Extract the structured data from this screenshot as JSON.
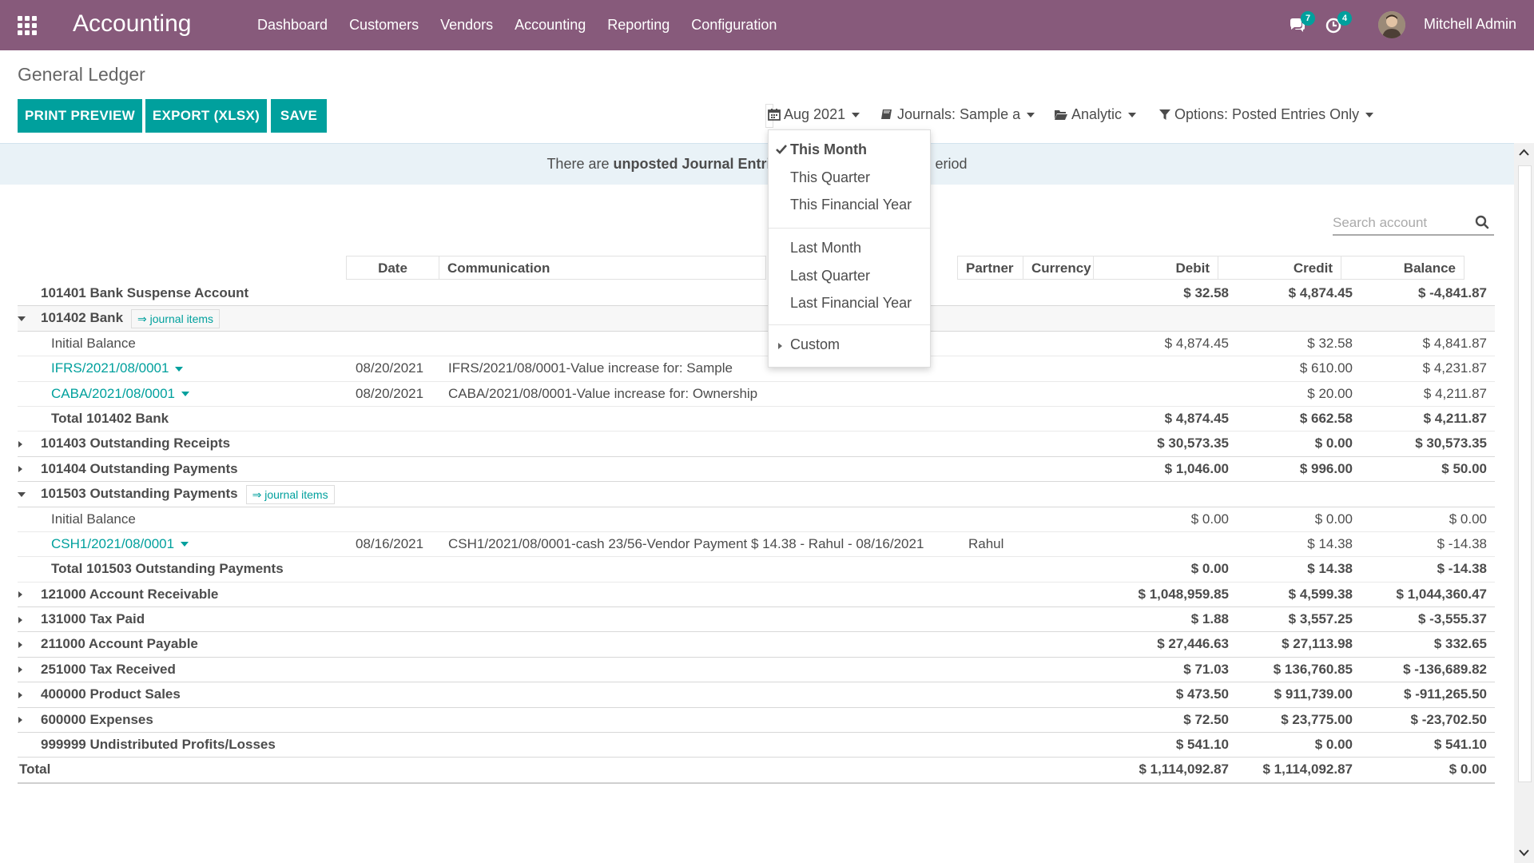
{
  "navbar": {
    "app_title": "Accounting",
    "menu": [
      "Dashboard",
      "Customers",
      "Vendors",
      "Accounting",
      "Reporting",
      "Configuration"
    ],
    "messages_count": "7",
    "activities_count": "4",
    "user_name": "Mitchell Admin",
    "color": "#875a7b"
  },
  "page": {
    "title": "General Ledger",
    "buttons": {
      "print_preview": "PRINT PREVIEW",
      "export": "EXPORT (XLSX)",
      "save": "SAVE"
    },
    "accent": "#00a09d"
  },
  "filters": {
    "date": "Aug 2021",
    "journals": "Journals: Sample a",
    "analytic": "Analytic",
    "options": "Options: Posted Entries Only"
  },
  "alert": {
    "prefix": "There are ",
    "bold": "unposted Journal Entrie",
    "suffix": "eriod"
  },
  "search": {
    "placeholder": "Search account"
  },
  "table": {
    "headers": {
      "date": "Date",
      "communication": "Communication",
      "partner": "Partner",
      "currency": "Currency",
      "debit": "Debit",
      "credit": "Credit",
      "balance": "Balance"
    },
    "r1": {
      "name": "101401 Bank Suspense Account",
      "debit": "$ 32.58",
      "credit": "$ 4,874.45",
      "balance": "$ -4,841.87"
    },
    "r2": {
      "name": "101402 Bank",
      "link": "⇒ journal items"
    },
    "r3": {
      "name": "Initial Balance",
      "debit": "$ 4,874.45",
      "credit": "$ 32.58",
      "balance": "$ 4,841.87"
    },
    "r4": {
      "name": "IFRS/2021/08/0001",
      "date": "08/20/2021",
      "comm": "IFRS/2021/08/0001-Value increase for: Sample",
      "credit": "$ 610.00",
      "balance": "$ 4,231.87"
    },
    "r5": {
      "name": "CABA/2021/08/0001",
      "date": "08/20/2021",
      "comm": "CABA/2021/08/0001-Value increase for: Ownership",
      "credit": "$ 20.00",
      "balance": "$ 4,211.87"
    },
    "r6": {
      "name": "Total 101402 Bank",
      "debit": "$ 4,874.45",
      "credit": "$ 662.58",
      "balance": "$ 4,211.87"
    },
    "r7": {
      "name": "101403 Outstanding Receipts",
      "debit": "$ 30,573.35",
      "credit": "$ 0.00",
      "balance": "$ 30,573.35"
    },
    "r8": {
      "name": "101404 Outstanding Payments",
      "debit": "$ 1,046.00",
      "credit": "$ 996.00",
      "balance": "$ 50.00"
    },
    "r9": {
      "name": "101503 Outstanding Payments",
      "link": "⇒ journal items"
    },
    "r10": {
      "name": "Initial Balance",
      "debit": "$ 0.00",
      "credit": "$ 0.00",
      "balance": "$ 0.00"
    },
    "r11": {
      "name": "CSH1/2021/08/0001",
      "date": "08/16/2021",
      "comm": "CSH1/2021/08/0001-cash 23/56-Vendor Payment $ 14.38 - Rahul - 08/16/2021",
      "partner": "Rahul",
      "credit": "$ 14.38",
      "balance": "$ -14.38"
    },
    "r12": {
      "name": "Total 101503 Outstanding Payments",
      "debit": "$ 0.00",
      "credit": "$ 14.38",
      "balance": "$ -14.38"
    },
    "r13": {
      "name": "121000 Account Receivable",
      "debit": "$ 1,048,959.85",
      "credit": "$ 4,599.38",
      "balance": "$ 1,044,360.47"
    },
    "r14": {
      "name": "131000 Tax Paid",
      "debit": "$ 1.88",
      "credit": "$ 3,557.25",
      "balance": "$ -3,555.37"
    },
    "r15": {
      "name": "211000 Account Payable",
      "debit": "$ 27,446.63",
      "credit": "$ 27,113.98",
      "balance": "$ 332.65"
    },
    "r16": {
      "name": "251000 Tax Received",
      "debit": "$ 71.03",
      "credit": "$ 136,760.85",
      "balance": "$ -136,689.82"
    },
    "r17": {
      "name": "400000 Product Sales",
      "debit": "$ 473.50",
      "credit": "$ 911,739.00",
      "balance": "$ -911,265.50"
    },
    "r18": {
      "name": "600000 Expenses",
      "debit": "$ 72.50",
      "credit": "$ 23,775.00",
      "balance": "$ -23,702.50"
    },
    "r19": {
      "name": "999999 Undistributed Profits/Losses",
      "debit": "$ 541.10",
      "credit": "$ 0.00",
      "balance": "$ 541.10"
    },
    "r20": {
      "name": "Total",
      "debit": "$ 1,114,092.87",
      "credit": "$ 1,114,092.87",
      "balance": "$ 0.00"
    }
  },
  "date_dropdown": {
    "this_month": "This Month",
    "this_quarter": "This Quarter",
    "this_year": "This Financial Year",
    "last_month": "Last Month",
    "last_quarter": "Last Quarter",
    "last_year": "Last Financial Year",
    "custom": "Custom"
  },
  "icons": [
    "apps-grid-icon",
    "chat-icon",
    "clock-icon",
    "calendar-icon",
    "book-icon",
    "folder-icon",
    "filter-icon",
    "search-icon",
    "check-icon"
  ]
}
